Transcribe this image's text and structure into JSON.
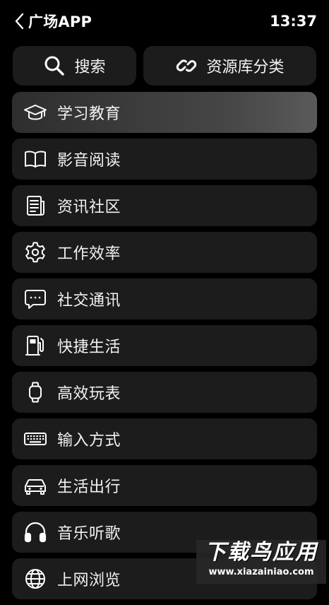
{
  "header": {
    "back_icon": "chevron-left-icon",
    "title": "广场APP",
    "time": "13:37"
  },
  "top_buttons": [
    {
      "label": "搜索",
      "icon": "search-icon"
    },
    {
      "label": "资源库分类",
      "icon": "link-icon"
    }
  ],
  "categories": [
    {
      "label": "学习教育",
      "icon": "graduation-cap-icon",
      "selected": true
    },
    {
      "label": "影音阅读",
      "icon": "open-book-icon"
    },
    {
      "label": "资讯社区",
      "icon": "newspaper-icon"
    },
    {
      "label": "工作效率",
      "icon": "gear-icon"
    },
    {
      "label": "社交通讯",
      "icon": "chat-bubble-icon"
    },
    {
      "label": "快捷生活",
      "icon": "fuel-pump-icon"
    },
    {
      "label": "高效玩表",
      "icon": "watch-icon"
    },
    {
      "label": "输入方式",
      "icon": "keyboard-icon"
    },
    {
      "label": "生活出行",
      "icon": "car-icon"
    },
    {
      "label": "音乐听歌",
      "icon": "headphones-icon"
    },
    {
      "label": "上网浏览",
      "icon": "globe-icon"
    }
  ],
  "watermark": {
    "text": "下载鸟应用",
    "url": "www.xiazainiao.com"
  }
}
